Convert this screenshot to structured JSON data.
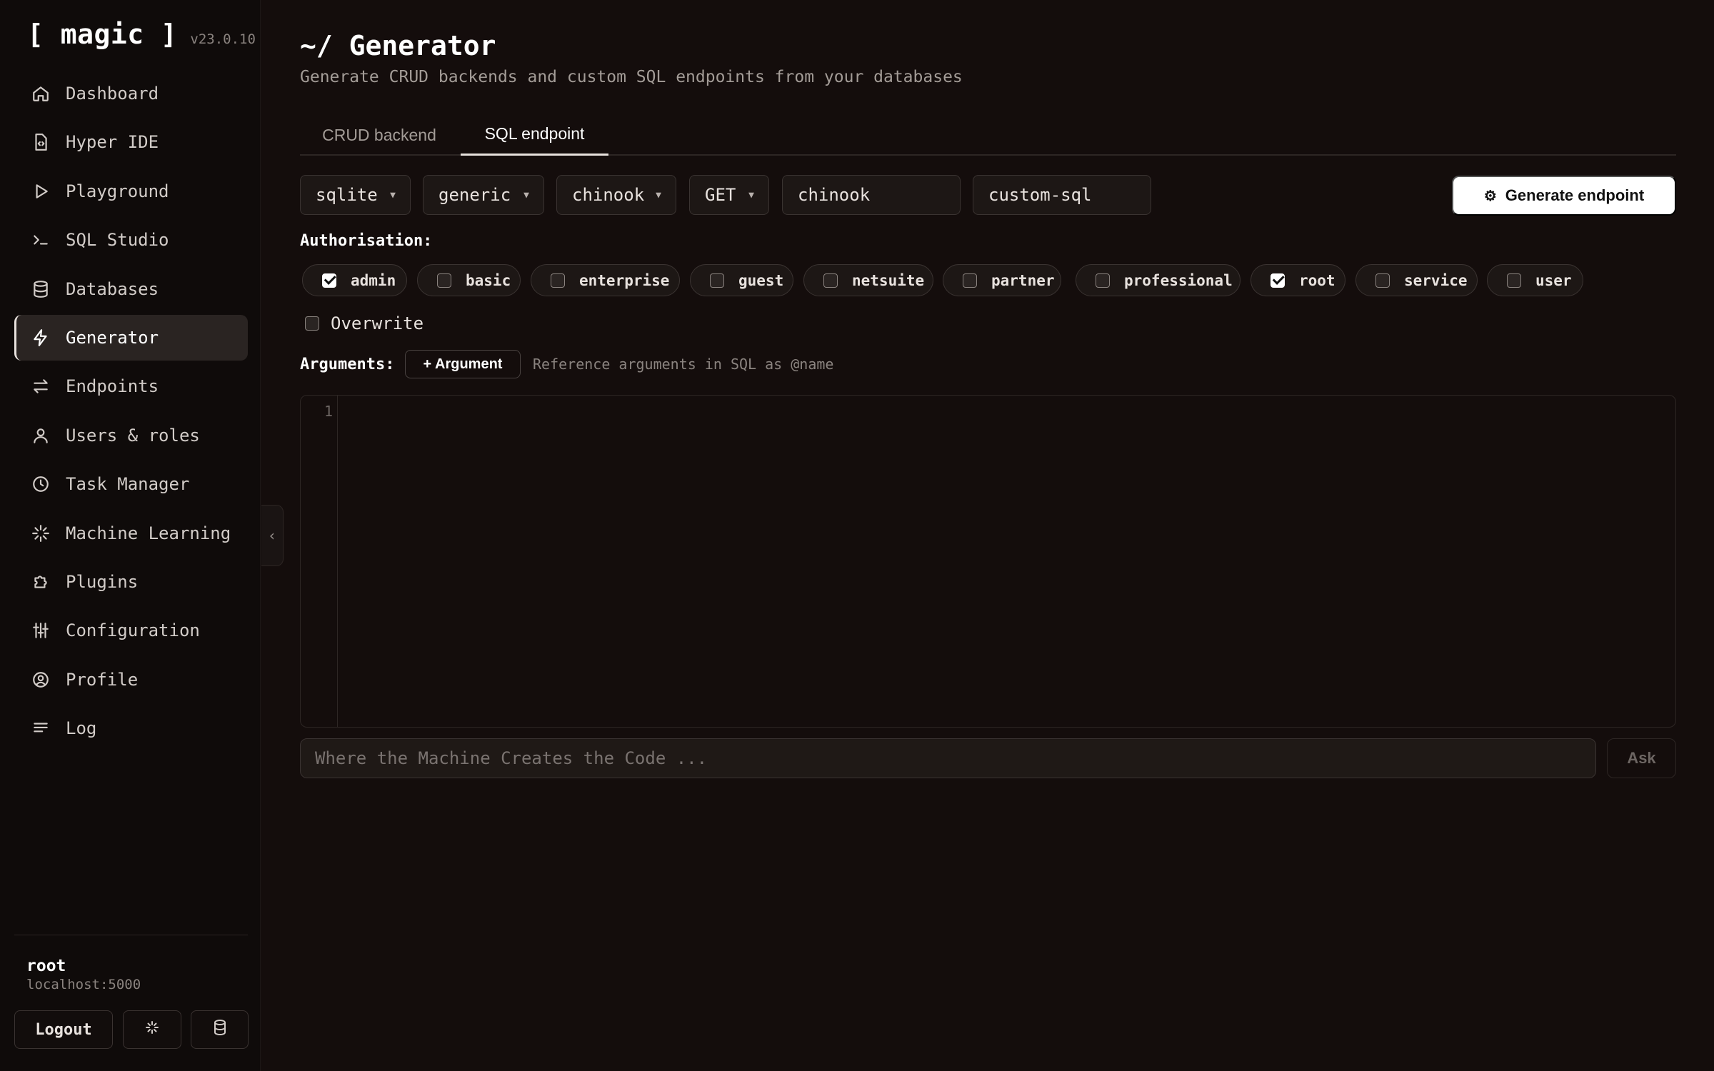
{
  "brand": {
    "name": "[ magic ]",
    "version": "v23.0.10"
  },
  "sidebar": {
    "items": [
      {
        "label": "Dashboard",
        "icon": "home-icon"
      },
      {
        "label": "Hyper IDE",
        "icon": "code-file-icon"
      },
      {
        "label": "Playground",
        "icon": "play-icon"
      },
      {
        "label": "SQL Studio",
        "icon": "terminal-icon"
      },
      {
        "label": "Databases",
        "icon": "database-icon"
      },
      {
        "label": "Generator",
        "icon": "lightning-icon",
        "active": true
      },
      {
        "label": "Endpoints",
        "icon": "arrows-icon"
      },
      {
        "label": "Users & roles",
        "icon": "user-icon"
      },
      {
        "label": "Task Manager",
        "icon": "clock-icon"
      },
      {
        "label": "Machine Learning",
        "icon": "spinner-icon"
      },
      {
        "label": "Plugins",
        "icon": "puzzle-icon"
      },
      {
        "label": "Configuration",
        "icon": "sliders-icon"
      },
      {
        "label": "Profile",
        "icon": "user-circle-icon"
      },
      {
        "label": "Log",
        "icon": "list-icon"
      }
    ],
    "user": {
      "name": "root",
      "host": "localhost:5000"
    },
    "logout_label": "Logout"
  },
  "header": {
    "title": "~/ Generator",
    "subtitle": "Generate CRUD backends and custom SQL endpoints from your databases"
  },
  "tabs": [
    {
      "label": "CRUD backend",
      "active": false
    },
    {
      "label": "SQL endpoint",
      "active": true
    }
  ],
  "form": {
    "database_type": "sqlite",
    "connection": "generic",
    "database": "chinook",
    "verb": "GET",
    "module": "chinook",
    "endpoint_name": "custom-sql",
    "generate_label": "Generate endpoint"
  },
  "authorisation": {
    "label": "Authorisation:",
    "roles": [
      {
        "name": "admin",
        "checked": true
      },
      {
        "name": "basic",
        "checked": false
      },
      {
        "name": "enterprise",
        "checked": false
      },
      {
        "name": "guest",
        "checked": false
      },
      {
        "name": "netsuite",
        "checked": false
      },
      {
        "name": "partner",
        "checked": false
      },
      {
        "name": "professional",
        "checked": false
      },
      {
        "name": "root",
        "checked": true
      },
      {
        "name": "service",
        "checked": false
      },
      {
        "name": "user",
        "checked": false
      }
    ]
  },
  "overwrite": {
    "label": "Overwrite",
    "checked": false
  },
  "arguments": {
    "label": "Arguments:",
    "add_label": "+ Argument",
    "hint": "Reference arguments in SQL as @name"
  },
  "editor": {
    "line_number": "1"
  },
  "ask": {
    "placeholder": "Where the Machine Creates the Code ...",
    "button_label": "Ask"
  }
}
